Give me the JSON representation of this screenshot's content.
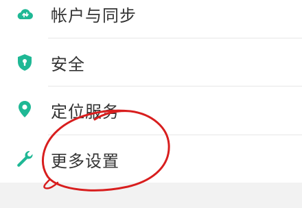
{
  "colors": {
    "accent": "#1fb895",
    "annotation_circle": "#d81e1e"
  },
  "settings_list": {
    "items": [
      {
        "label": "帐户与同步",
        "icon": "cloud-sync-icon"
      },
      {
        "label": "安全",
        "icon": "shield-icon"
      },
      {
        "label": "定位服务",
        "icon": "location-pin-icon"
      },
      {
        "label": "更多设置",
        "icon": "wrench-icon"
      }
    ]
  }
}
